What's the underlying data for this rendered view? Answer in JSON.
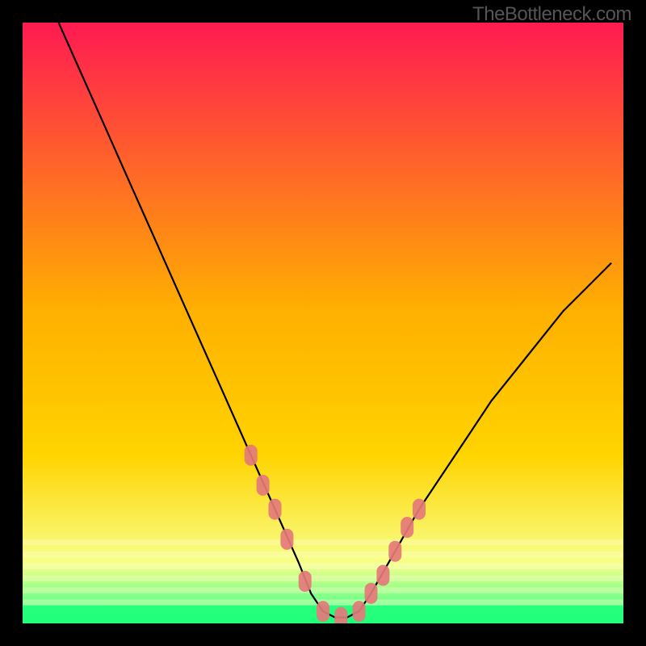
{
  "watermark": "TheBottleneck.com",
  "chart_data": {
    "type": "line",
    "title": "",
    "xlabel": "",
    "ylabel": "",
    "xlim": [
      0,
      100
    ],
    "ylim": [
      0,
      100
    ],
    "curve": {
      "name": "bottleneck-curve",
      "x": [
        6,
        10,
        14,
        18,
        22,
        26,
        30,
        34,
        38,
        42,
        46,
        48,
        50,
        52,
        54,
        56,
        58,
        62,
        66,
        70,
        74,
        78,
        82,
        86,
        90,
        94,
        98
      ],
      "y": [
        100,
        91,
        82,
        73,
        64,
        55,
        46,
        37,
        28,
        19,
        10,
        5,
        2,
        1,
        1,
        2,
        5,
        12,
        19,
        25,
        31,
        37,
        42,
        47,
        52,
        56,
        60
      ]
    },
    "markers": {
      "name": "highlighted-points",
      "x": [
        38,
        40,
        42,
        44,
        47,
        50,
        53,
        56,
        58,
        60,
        62,
        64,
        66
      ],
      "y": [
        28,
        23,
        19,
        14,
        7,
        2,
        1,
        2,
        5,
        8,
        12,
        16,
        19
      ]
    },
    "green_band": {
      "y_from": 0,
      "y_to": 3
    },
    "yellow_band": {
      "y_from": 3,
      "y_to": 14
    },
    "gradient": {
      "top": "#ff1a52",
      "mid": "#ffd400",
      "bottom": "#1eff7a"
    },
    "marker_color": "#e47a7a",
    "curve_color": "#000000"
  }
}
